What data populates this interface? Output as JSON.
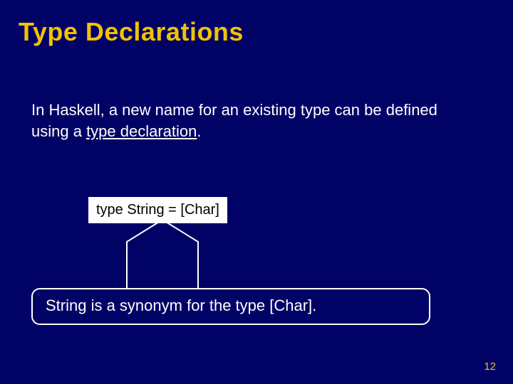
{
  "slide": {
    "title": "Type Declarations",
    "body_prefix": "In Haskell, a new name for an existing type can be defined using a ",
    "body_underlined": "type declaration",
    "body_suffix": ".",
    "code": "type String = [Char]",
    "callout": "String is a synonym for the type [Char].",
    "page_number": "12"
  }
}
